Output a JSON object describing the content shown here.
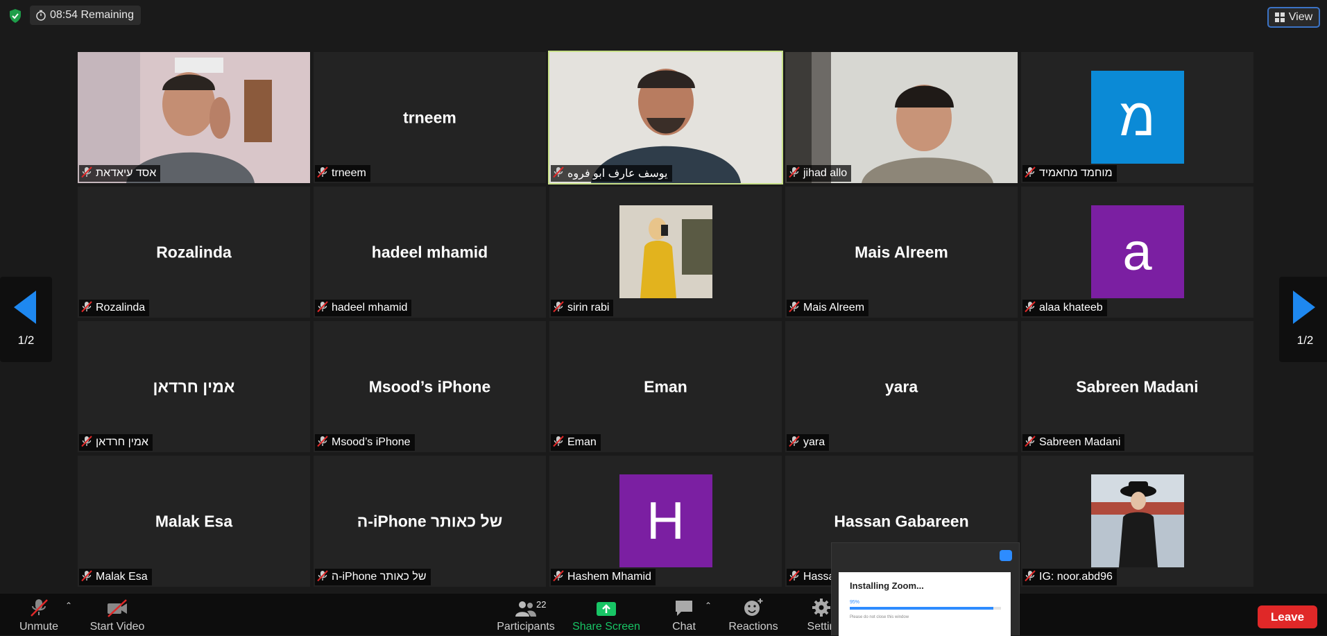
{
  "header": {
    "timer": "08:54 Remaining",
    "view_label": "View"
  },
  "pager": {
    "left_label": "1/2",
    "right_label": "1/2"
  },
  "tiles": [
    {
      "name": "אסד עיאדאת",
      "type": "camera"
    },
    {
      "name": "trneem",
      "type": "text",
      "big": "trneem"
    },
    {
      "name": "يوسف عارف ابو فروه",
      "type": "camera",
      "active": true
    },
    {
      "name": "jihad allo",
      "type": "camera"
    },
    {
      "name": "מוחמד מחאמיד",
      "type": "avatar",
      "letter": "מ",
      "color": "#0b8ad6"
    },
    {
      "name": "Rozalinda",
      "type": "text",
      "big": "Rozalinda"
    },
    {
      "name": "hadeel mhamid",
      "type": "text",
      "big": "hadeel mhamid"
    },
    {
      "name": "sirin rabi",
      "type": "photo"
    },
    {
      "name": "Mais Alreem",
      "type": "text",
      "big": "Mais Alreem"
    },
    {
      "name": "alaa khateeb",
      "type": "avatar",
      "letter": "a",
      "color": "#7b1fa2"
    },
    {
      "name": "אמין חרדאן",
      "type": "text",
      "big": "אמין חרדאן"
    },
    {
      "name": "Msood’s iPhone",
      "type": "text",
      "big": "Msood’s iPhone"
    },
    {
      "name": "Eman",
      "type": "text",
      "big": "Eman"
    },
    {
      "name": "yara",
      "type": "text",
      "big": "yara"
    },
    {
      "name": "Sabreen Madani",
      "type": "text",
      "big": "Sabreen Madani"
    },
    {
      "name": "Malak Esa",
      "type": "text",
      "big": "Malak Esa"
    },
    {
      "name": "ה-iPhone של כאותר",
      "type": "text",
      "big": "ה-iPhone של כאותר"
    },
    {
      "name": "Hashem Mhamid",
      "type": "avatar",
      "letter": "H",
      "color": "#7b1fa2"
    },
    {
      "name": "Hassa",
      "type": "text",
      "big": "Hassan Gabareen"
    },
    {
      "name": "IG: noor.abd96",
      "type": "photo"
    }
  ],
  "toolbar": {
    "unmute": "Unmute",
    "start_video": "Start Video",
    "participants": "Participants",
    "participants_count": "22",
    "share_screen": "Share Screen",
    "chat": "Chat",
    "reactions": "Reactions",
    "settings": "Settin",
    "leave": "Leave"
  },
  "install_popup": {
    "title": "Installing Zoom...",
    "percent": "95%",
    "progress": 0.95,
    "note": "Please do not close this window"
  }
}
